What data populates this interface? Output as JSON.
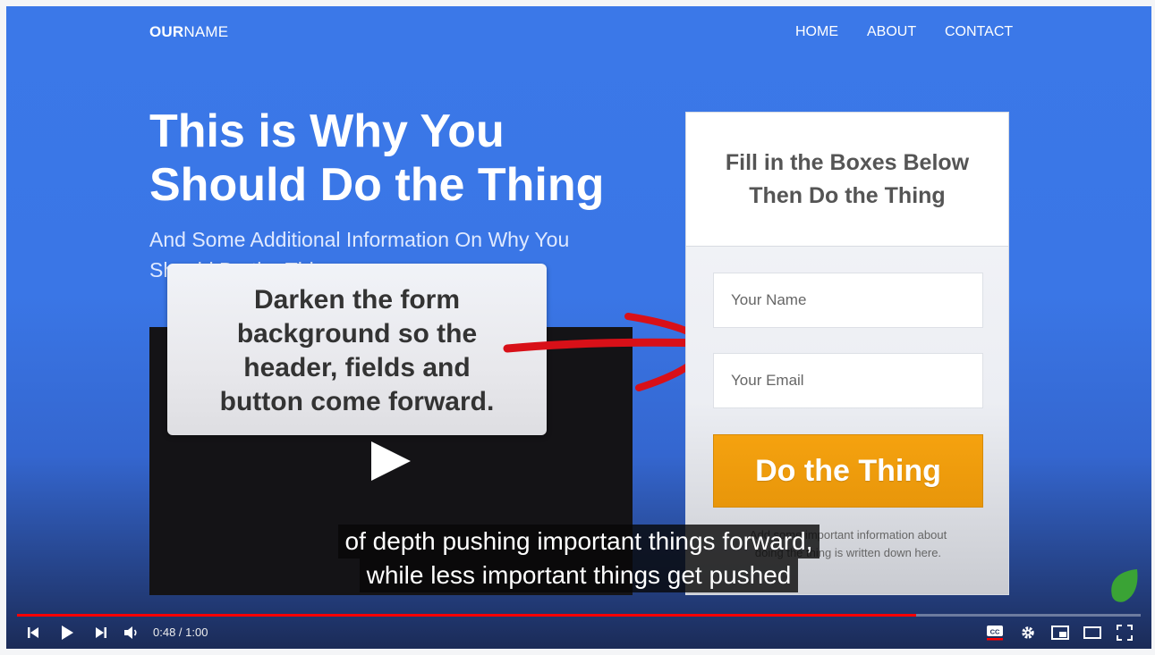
{
  "brand": {
    "bold": "OUR",
    "regular": "NAME"
  },
  "nav": {
    "home": "HOME",
    "about": "ABOUT",
    "contact": "CONTACT"
  },
  "hero": {
    "title_line1": "This is Why You",
    "title_line2": "Should Do the Thing",
    "subtitle_line1": "And Some Additional Information On Why You",
    "subtitle_line2": "Should Do the Thing"
  },
  "callout": {
    "line1": "Darken the form",
    "line2": "background so the",
    "line3": "header, fields and",
    "line4": "button come forward."
  },
  "form": {
    "heading_line1": "Fill in the Boxes Below",
    "heading_line2": "Then Do the Thing",
    "name_placeholder": "Your Name",
    "email_placeholder": "Your Email",
    "cta": "Do the Thing",
    "fine_line1": "Add some important information about",
    "fine_line2": "doing the thing is written down here."
  },
  "captions": {
    "line1": "of depth pushing important things forward,",
    "line2": "while less important things get pushed"
  },
  "player": {
    "time": "0:48 / 1:00",
    "progress": 0.8,
    "accent": "#ff0000",
    "icons": [
      "previous-icon",
      "play-icon",
      "next-icon",
      "volume-icon",
      "captions-icon",
      "settings-icon",
      "miniplayer-icon",
      "theater-icon",
      "fullscreen-icon"
    ]
  },
  "colors": {
    "hero_background": "#3b78e8",
    "cta": "#f0a00c",
    "annotation_arrow": "#d81018",
    "logo": "#3aa335"
  }
}
